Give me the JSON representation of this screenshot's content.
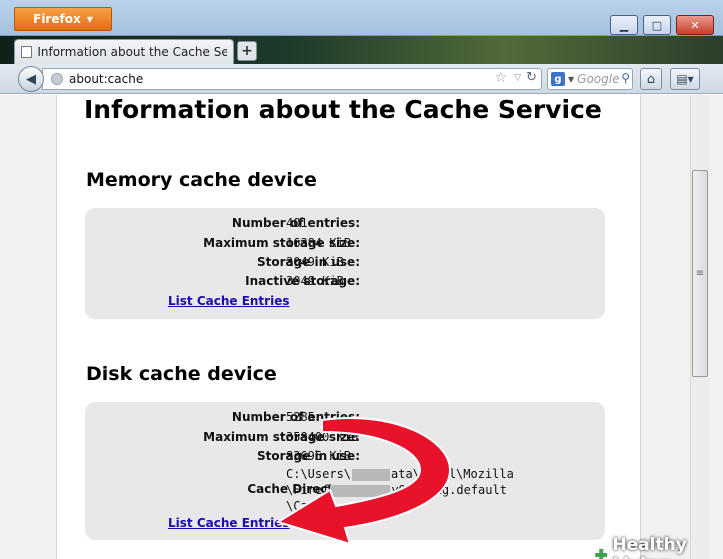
{
  "browser": {
    "menu_button": "Firefox",
    "window_controls": {
      "minimize": "▭",
      "maximize": "□",
      "close": "✕"
    },
    "tab": {
      "title": "Information about the Cache Se..."
    },
    "new_tab": "+",
    "address": "about:cache",
    "search_placeholder": "Google"
  },
  "page": {
    "title": "Information about the Cache Service",
    "memory": {
      "heading": "Memory cache device",
      "rows": [
        {
          "label": "Number of entries:",
          "value": "401"
        },
        {
          "label": "Maximum storage size:",
          "value": "16384 KiB"
        },
        {
          "label": "Storage in use:",
          "value": "3049 KiB"
        },
        {
          "label": "Inactive storage:",
          "value": "3049 KiB"
        }
      ],
      "link": "List Cache Entries"
    },
    "disk": {
      "heading": "Disk cache device",
      "rows": [
        {
          "label": "Number of entries:",
          "value": "5285"
        },
        {
          "label": "Maximum storage size:",
          "value": "358400 KiB"
        },
        {
          "label": "Storage in use:",
          "value": "83695 KiB"
        }
      ],
      "cache_directory": {
        "label": "Cache Directory:",
        "line1_a": "C:\\Users\\",
        "line1_b": "ata\\Local\\Mozilla",
        "line2_a": "\\Firef",
        "line2_b": "y944w6xg.default",
        "line3": "\\Cac"
      },
      "link": "List Cache Entries"
    }
  },
  "watermark": "Healthy Living",
  "colors": {
    "link": "#1a0dab",
    "arrow": "#e8132b",
    "box": "#e8e8e8"
  }
}
